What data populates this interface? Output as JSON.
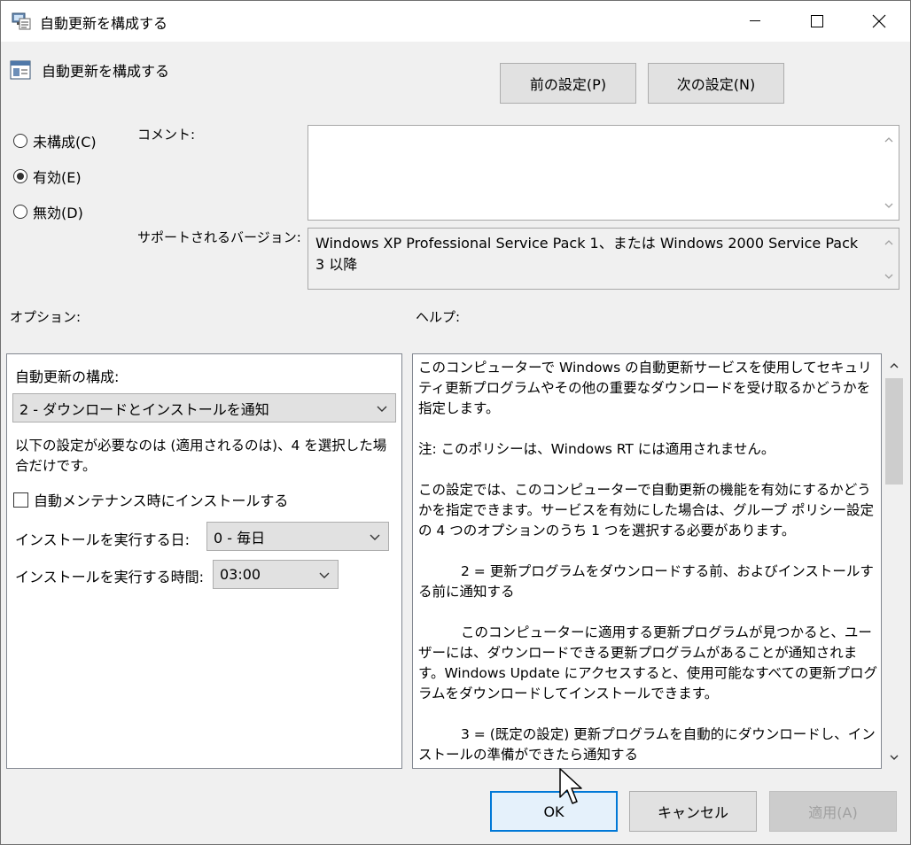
{
  "window": {
    "title": "自動更新を構成する"
  },
  "header": {
    "policy_name": "自動更新を構成する",
    "prev_button": "前の設定(P)",
    "next_button": "次の設定(N)"
  },
  "state": {
    "not_configured": "未構成(C)",
    "enabled": "有効(E)",
    "disabled": "無効(D)",
    "selected": "enabled"
  },
  "comment": {
    "label": "コメント:",
    "value": ""
  },
  "supported": {
    "label": "サポートされるバージョン:",
    "value": "Windows XP Professional Service Pack 1、または Windows 2000 Service Pack 3 以降"
  },
  "options": {
    "header": "オプション:",
    "configure_label": "自動更新の構成:",
    "configure_value": "2 - ダウンロードとインストールを通知",
    "note": "以下の設定が必要なのは (適用されるのは)、4 を選択した場合だけです。",
    "maintenance_checkbox": "自動メンテナンス時にインストールする",
    "maintenance_checked": false,
    "install_day_label": "インストールを実行する日:",
    "install_day_value": "0 - 毎日",
    "install_time_label": "インストールを実行する時間:",
    "install_time_value": "03:00"
  },
  "help": {
    "header": "ヘルプ:",
    "paragraphs": [
      "このコンピューターで Windows の自動更新サービスを使用してセキュリティ更新プログラムやその他の重要なダウンロードを受け取るかどうかを指定します。",
      "注: このポリシーは、Windows RT には適用されません。",
      "この設定では、このコンピューターで自動更新の機能を有効にするかどうかを指定できます。サービスを有効にした場合は、グループ ポリシー設定の 4 つのオプションのうち 1 つを選択する必要があります。",
      "2 = 更新プログラムをダウンロードする前、およびインストールする前に通知する",
      "このコンピューターに適用する更新プログラムが見つかると、ユーザーには、ダウンロードできる更新プログラムがあることが通知されます。Windows Update にアクセスすると、使用可能なすべての更新プログラムをダウンロードしてインストールできます。",
      "3 = (既定の設定) 更新プログラムを自動的にダウンロードし、インストールの準備ができたら通知する"
    ]
  },
  "footer": {
    "ok": "OK",
    "cancel": "キャンセル",
    "apply": "適用(A)"
  },
  "colors": {
    "accent": "#0078d7",
    "window_bg": "#f0f0f0"
  }
}
